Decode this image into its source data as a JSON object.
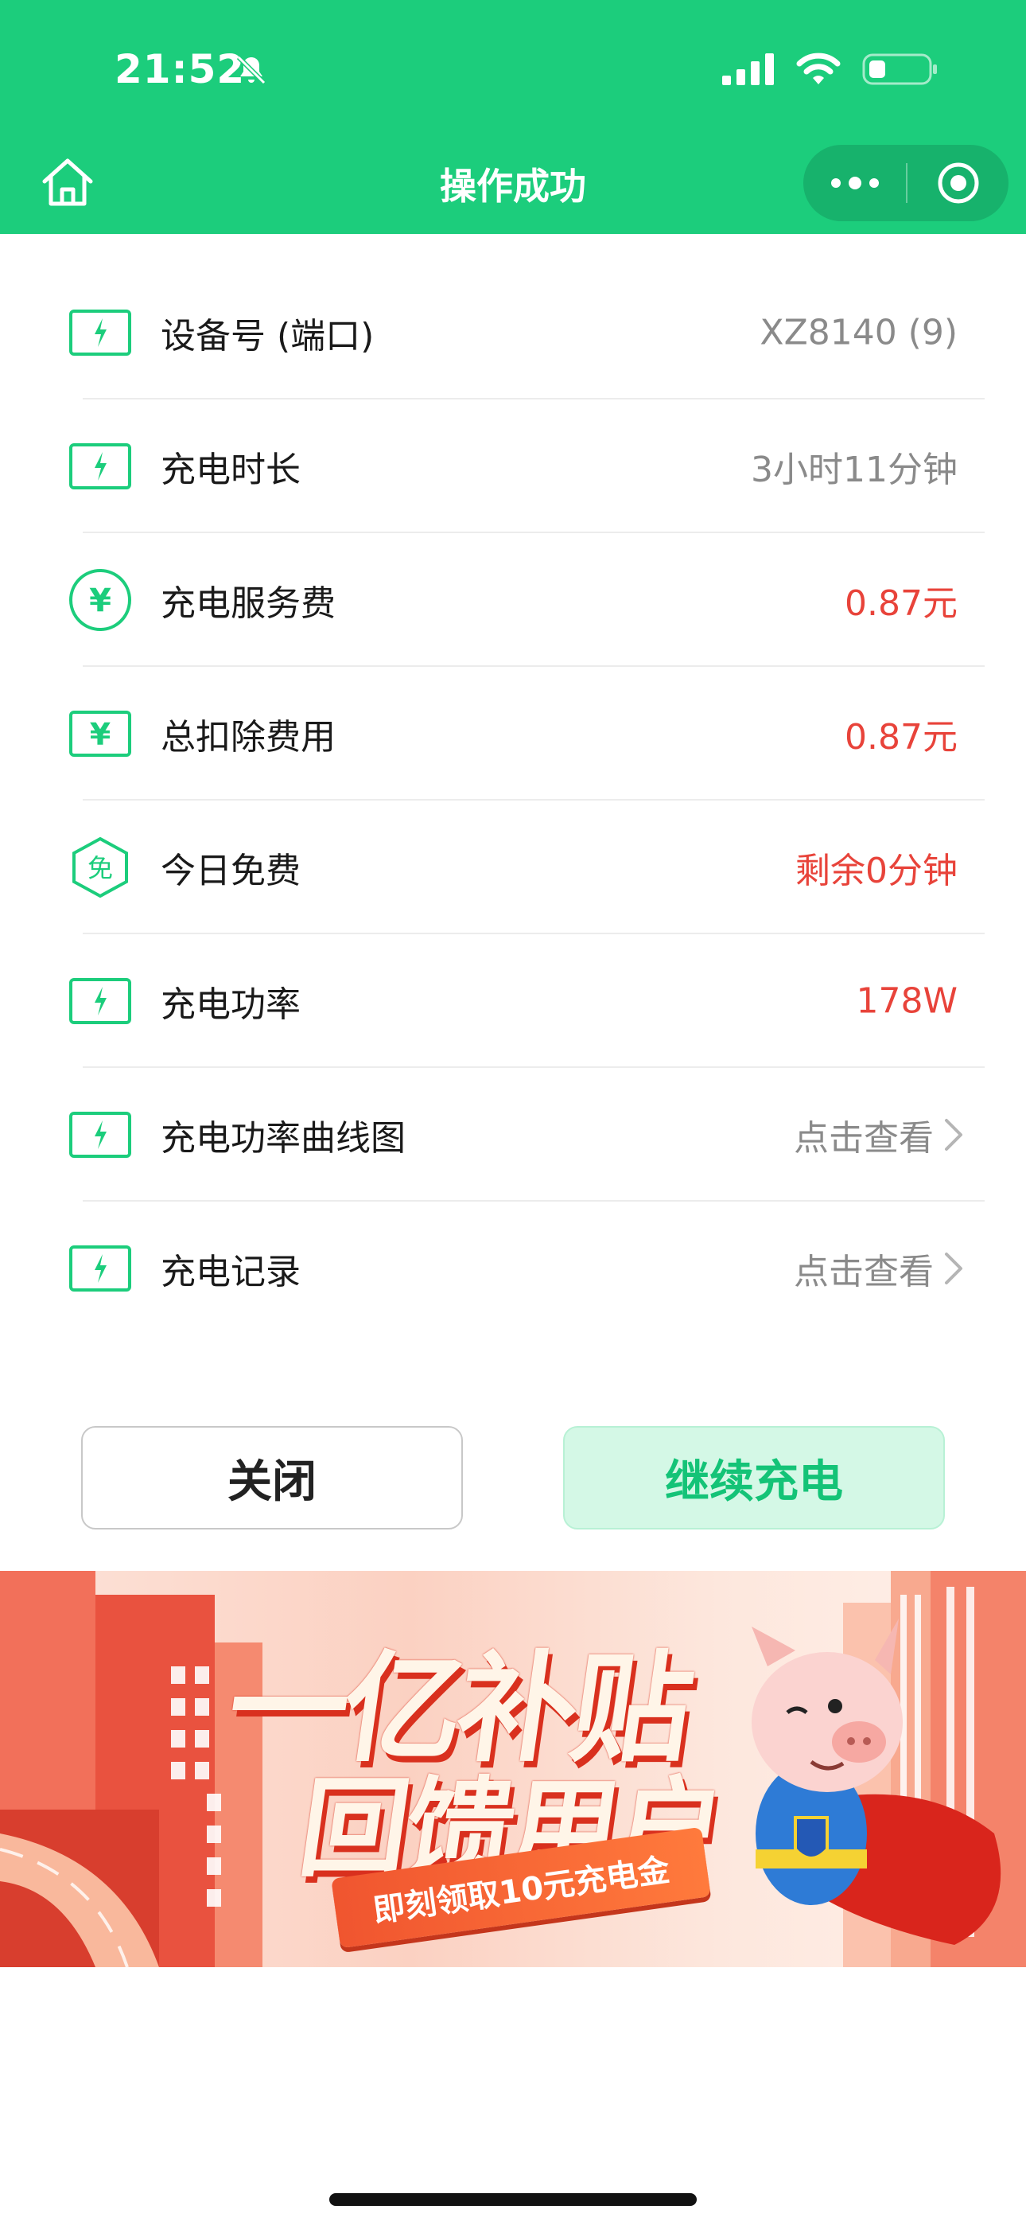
{
  "status_bar": {
    "time": "21:52"
  },
  "nav": {
    "title": "操作成功"
  },
  "rows": [
    {
      "label": "设备号 (端口)",
      "value": "XZ8140 (9)",
      "icon": "bolt-square-icon",
      "tone": "grey"
    },
    {
      "label": "充电时长",
      "value": "3小时11分钟",
      "icon": "bolt-square-icon",
      "tone": "grey"
    },
    {
      "label": "充电服务费",
      "value": "0.87元",
      "icon": "yen-circle-icon",
      "tone": "red"
    },
    {
      "label": "总扣除费用",
      "value": "0.87元",
      "icon": "yen-square-icon",
      "tone": "red"
    },
    {
      "label": "今日免费",
      "value": "剩余0分钟",
      "icon": "free-hexagon-icon",
      "icon_text": "免",
      "tone": "red"
    },
    {
      "label": "充电功率",
      "value": "178W",
      "icon": "bolt-square-icon",
      "tone": "red"
    },
    {
      "label": "充电功率曲线图",
      "value": "点击查看",
      "icon": "bolt-square-icon",
      "tone": "link"
    },
    {
      "label": "充电记录",
      "value": "点击查看",
      "icon": "bolt-square-icon",
      "tone": "link"
    }
  ],
  "buttons": {
    "close": "关闭",
    "continue": "继续充电"
  },
  "banner": {
    "line1": "一亿补贴",
    "line2": "回馈用户",
    "subtitle": "即刻领取10元充电金"
  },
  "colors": {
    "brand_green": "#1ccd7c",
    "accent_red": "#e8433a",
    "muted_grey": "#8a8a8a"
  }
}
